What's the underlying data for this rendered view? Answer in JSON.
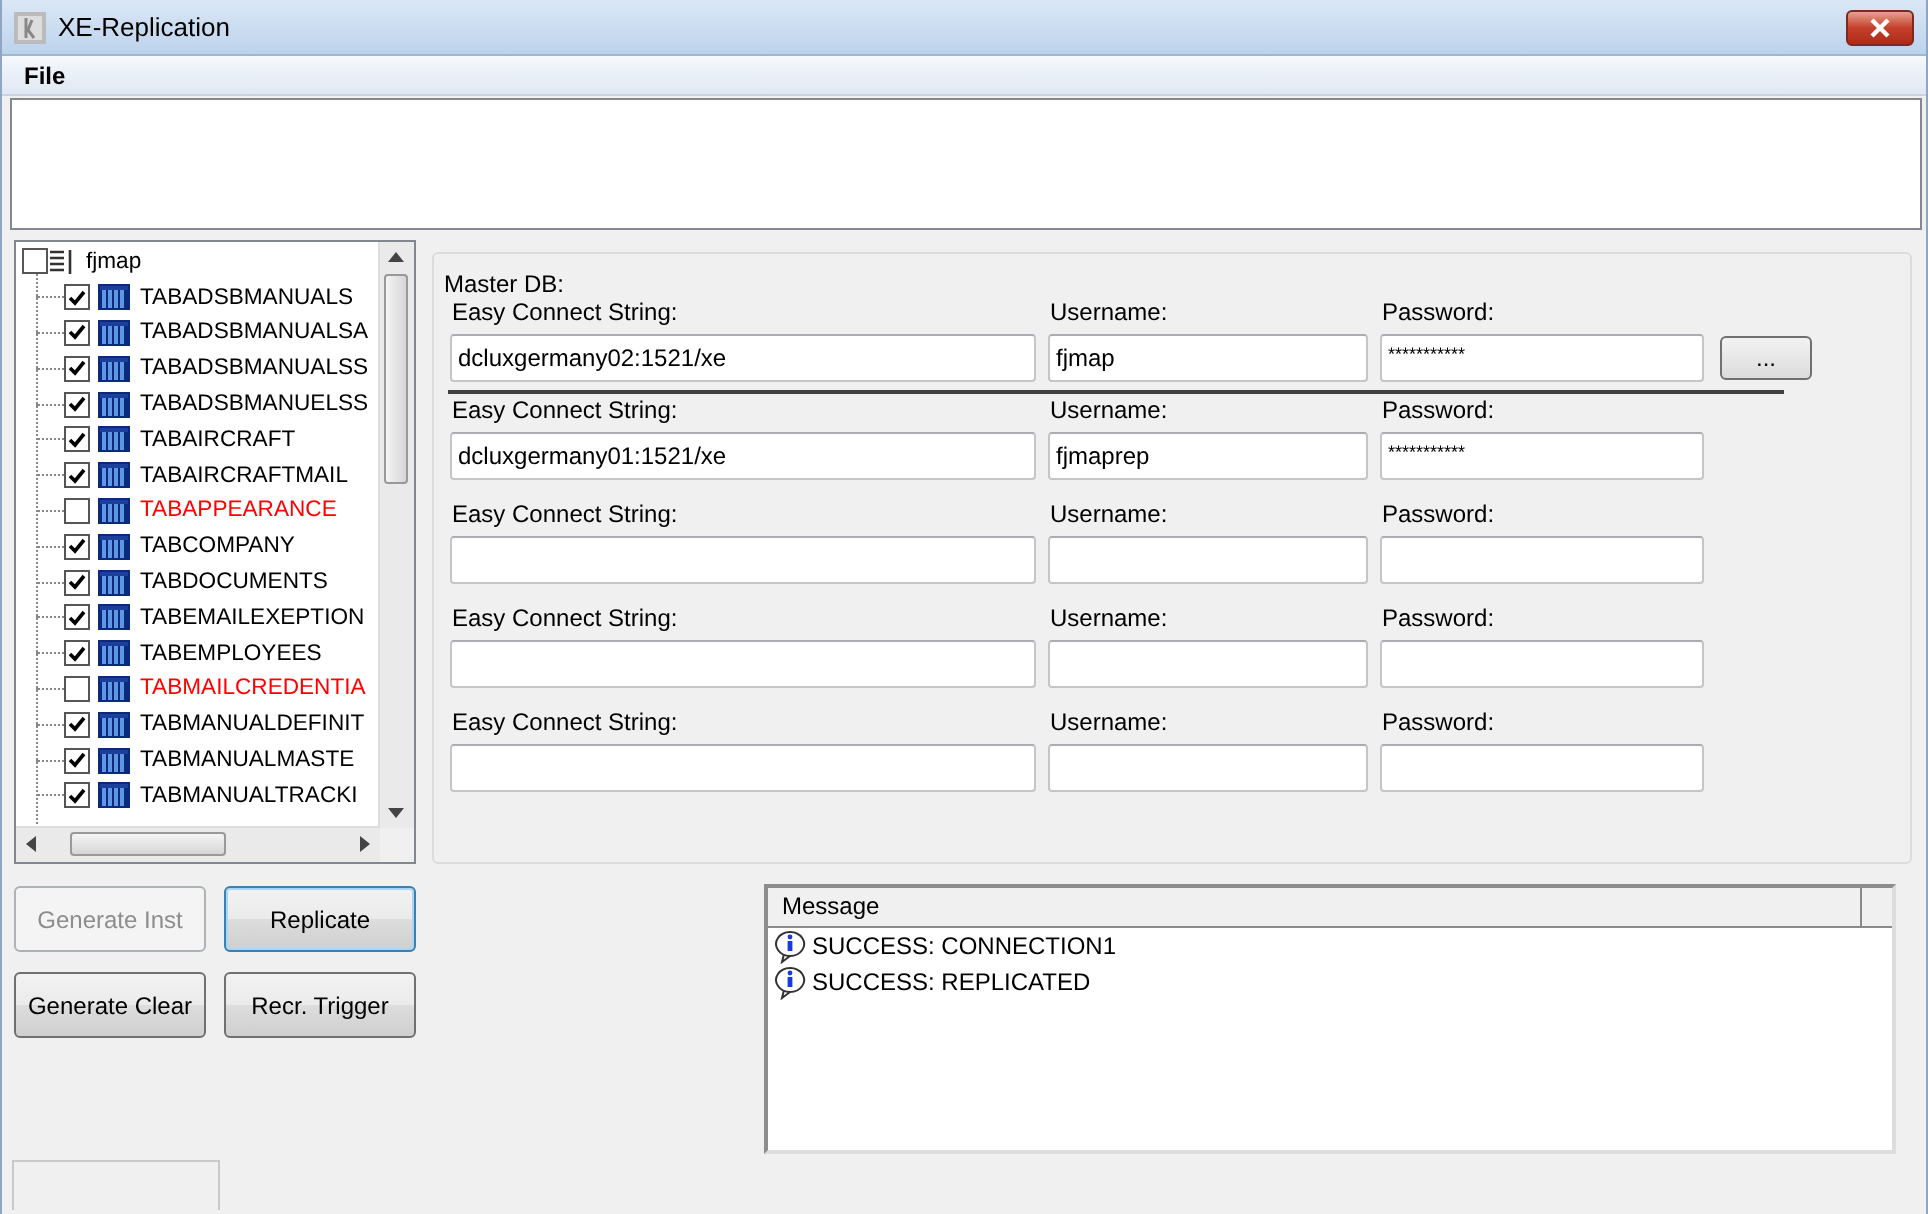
{
  "window": {
    "title": "XE-Replication"
  },
  "menu": [
    {
      "label": "File"
    }
  ],
  "tree": {
    "label": "fjmap",
    "checked": false,
    "children": [
      {
        "label": "TABADSBMANUALS",
        "checked": true
      },
      {
        "label": "TABADSBMANUALSA",
        "checked": true
      },
      {
        "label": "TABADSBMANUALSS",
        "checked": true
      },
      {
        "label": "TABADSBMANUELSS",
        "checked": true
      },
      {
        "label": "TABAIRCRAFT",
        "checked": true
      },
      {
        "label": "TABAIRCRAFTMAIL",
        "checked": true
      },
      {
        "label": "TABAPPEARANCE",
        "checked": false
      },
      {
        "label": "TABCOMPANY",
        "checked": true
      },
      {
        "label": "TABDOCUMENTS",
        "checked": true
      },
      {
        "label": "TABEMAILEXEPTION",
        "checked": true
      },
      {
        "label": "TABEMPLOYEES",
        "checked": true
      },
      {
        "label": "TABMAILCREDENTIA",
        "checked": false
      },
      {
        "label": "TABMANUALDEFINIT",
        "checked": true
      },
      {
        "label": "TABMANUALMASTE",
        "checked": true
      },
      {
        "label": "TABMANUALTRACKI",
        "checked": true
      }
    ]
  },
  "master_label": "Master DB:",
  "connections": [
    {
      "connect_label": "Easy Connect String:",
      "connect_string": "dcluxgermany02:1521/xe",
      "username_label": "Username:",
      "username": "fjmap",
      "password_label": "Password:",
      "password": "***********",
      "browse_button": "..."
    },
    {
      "connect_label": "Easy Connect String:",
      "connect_string": "dcluxgermany01:1521/xe",
      "username_label": "Username:",
      "username": "fjmaprep",
      "password_label": "Password:",
      "password": "***********"
    },
    {
      "connect_label": "Easy Connect String:",
      "username_label": "Username:",
      "password_label": "Password:"
    },
    {
      "connect_label": "Easy Connect String:",
      "username_label": "Username:",
      "password_label": "Password:"
    },
    {
      "connect_label": "Easy Connect String:",
      "username_label": "Username:",
      "password_label": "Password:"
    }
  ],
  "buttons": [
    {
      "label": "Generate Inst",
      "disabled": true,
      "focused": false
    },
    {
      "label": "Replicate",
      "disabled": false,
      "focused": true
    },
    {
      "label": "Generate Clear",
      "disabled": false,
      "focused": false
    },
    {
      "label": "Recr. Trigger",
      "disabled": false,
      "focused": false
    }
  ],
  "messages": {
    "column": "Message",
    "rows": [
      {
        "text": "SUCCESS: CONNECTION1"
      },
      {
        "text": "SUCCESS: REPLICATED"
      }
    ]
  }
}
